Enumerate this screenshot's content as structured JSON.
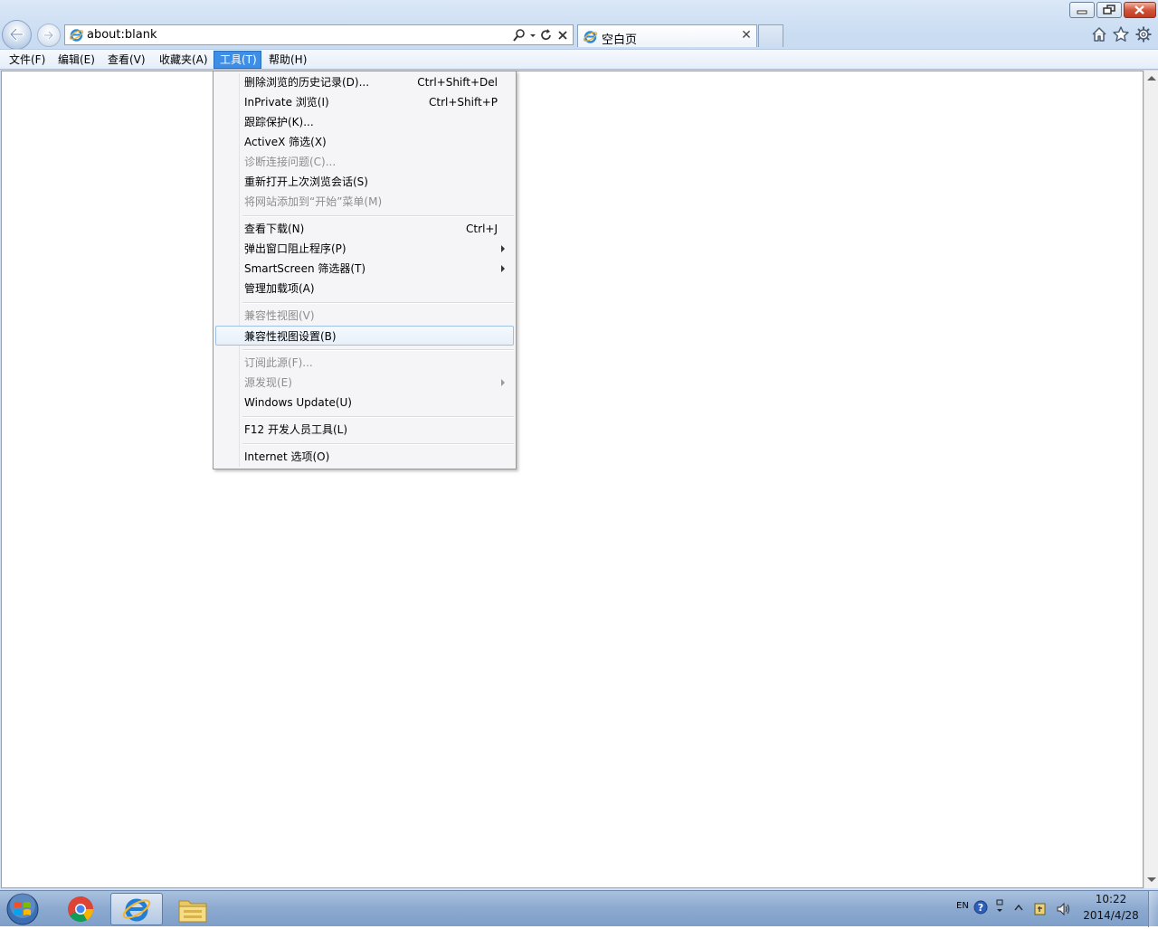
{
  "window": {
    "controls": [
      "minimize-icon",
      "restore-icon",
      "close-icon"
    ]
  },
  "address": {
    "url": "about:blank",
    "icons": [
      "search-icon",
      "dropdown-icon",
      "refresh-icon",
      "stop-icon"
    ]
  },
  "tab": {
    "title": "空白页",
    "close_label": "✕"
  },
  "toolbar_icons": [
    "home-icon",
    "favorites-star-icon",
    "tools-gear-icon"
  ],
  "menubar": {
    "items": [
      {
        "label": "文件(F)"
      },
      {
        "label": "编辑(E)"
      },
      {
        "label": "查看(V)"
      },
      {
        "label": "收藏夹(A)"
      },
      {
        "label": "工具(T)",
        "open": true
      },
      {
        "label": "帮助(H)"
      }
    ]
  },
  "tools_menu": {
    "items": [
      {
        "label": "删除浏览的历史记录(D)...",
        "shortcut": "Ctrl+Shift+Del"
      },
      {
        "label": "InPrivate 浏览(I)",
        "shortcut": "Ctrl+Shift+P"
      },
      {
        "label": "跟踪保护(K)..."
      },
      {
        "label": "ActiveX 筛选(X)"
      },
      {
        "label": "诊断连接问题(C)...",
        "disabled": true
      },
      {
        "label": "重新打开上次浏览会话(S)"
      },
      {
        "label": "将网站添加到“开始”菜单(M)",
        "disabled": true
      },
      {
        "label": "查看下载(N)",
        "shortcut": "Ctrl+J"
      },
      {
        "label": "弹出窗口阻止程序(P)",
        "submenu": true
      },
      {
        "label": "SmartScreen 筛选器(T)",
        "submenu": true
      },
      {
        "label": "管理加载项(A)"
      },
      {
        "label": "兼容性视图(V)",
        "disabled": true
      },
      {
        "label": "兼容性视图设置(B)",
        "highlighted": true
      },
      {
        "label": "订阅此源(F)...",
        "disabled": true
      },
      {
        "label": "源发现(E)",
        "disabled": true,
        "submenu": true
      },
      {
        "label": "Windows Update(U)"
      },
      {
        "label": "F12 开发人员工具(L)"
      },
      {
        "label": "Internet 选项(O)"
      }
    ]
  },
  "taskbar": {
    "buttons": [
      "windows-start-icon",
      "chrome-icon",
      "internet-explorer-icon",
      "file-explorer-icon"
    ],
    "tray": {
      "language": "EN",
      "time": "10:22",
      "date": "2014/4/28"
    }
  },
  "colors": {
    "menu_highlight": "#3d8ee6",
    "frame": "#cfe0f4",
    "close_button": "#c13b22"
  }
}
